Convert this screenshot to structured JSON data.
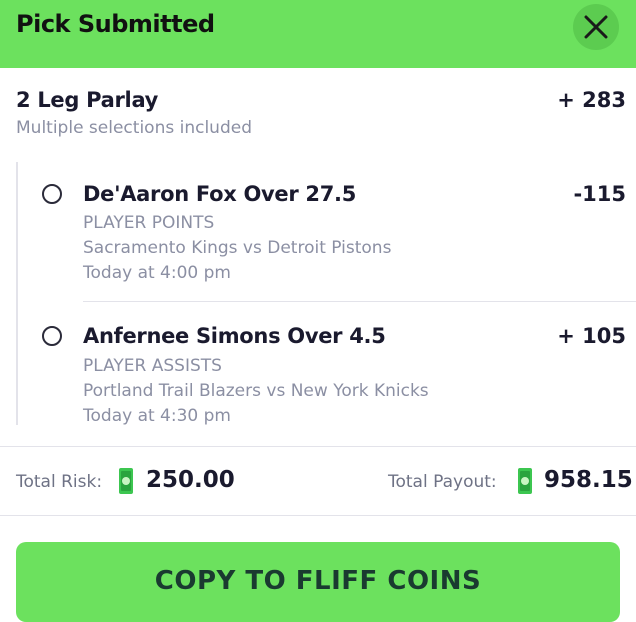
{
  "header": {
    "title": "Pick Submitted"
  },
  "parlay": {
    "title": "2 Leg Parlay",
    "odds": "+ 283",
    "subtitle": "Multiple selections included"
  },
  "legs": [
    {
      "title": "De'Aaron Fox Over 27.5",
      "odds": "-115",
      "market": "PLAYER POINTS",
      "matchup": "Sacramento Kings vs Detroit Pistons",
      "time": "Today at 4:00 pm"
    },
    {
      "title": "Anfernee Simons Over 4.5",
      "odds": "+ 105",
      "market": "PLAYER ASSISTS",
      "matchup": "Portland Trail Blazers vs New York Knicks",
      "time": "Today at 4:30 pm"
    }
  ],
  "totals": {
    "risk_label": "Total Risk:",
    "risk_value": "250.00",
    "payout_label": "Total Payout:",
    "payout_value": "958.15",
    "coin_icon": "cash-coin-icon"
  },
  "actions": {
    "copy_label": "COPY TO FLIFF COINS"
  },
  "colors": {
    "accent": "#6ce15e",
    "text": "#1a1a2e",
    "muted": "#8b8fa3"
  }
}
